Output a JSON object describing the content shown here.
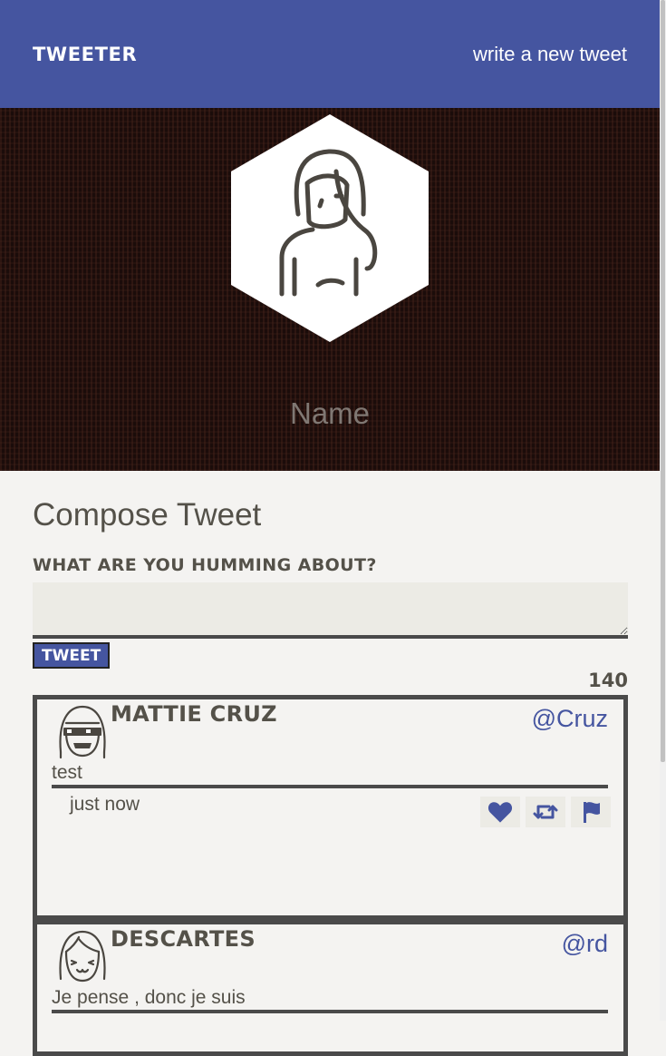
{
  "nav": {
    "brand": "Tweeter",
    "compose_link": "write a new tweet"
  },
  "profile": {
    "name": "Name"
  },
  "compose": {
    "title": "Compose Tweet",
    "label": "What are you humming about?",
    "textarea_value": "",
    "button_label": "Tweet",
    "char_counter": "140"
  },
  "tweets": [
    {
      "name": "Mattie Cruz",
      "handle": "@Cruz",
      "content": "test",
      "time": "just now"
    },
    {
      "name": "Descartes",
      "handle": "@rd",
      "content": "Je pense , donc je suis"
    }
  ],
  "colors": {
    "accent": "#4555a0",
    "background": "#f4f3f1",
    "text": "#545149",
    "banner": "#1b0c0a"
  },
  "icons": {
    "like": "heart-icon",
    "retweet": "retweet-icon",
    "flag": "flag-icon"
  }
}
